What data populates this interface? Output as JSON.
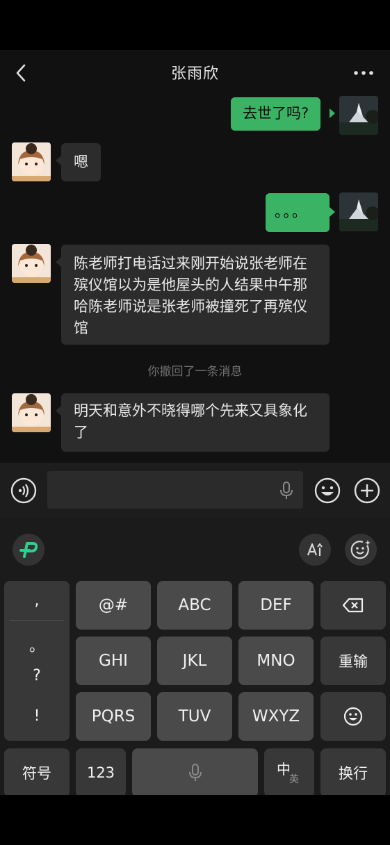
{
  "header": {
    "title": "张雨欣"
  },
  "messages": [
    {
      "side": "out",
      "text": "去世了吗?"
    },
    {
      "side": "in",
      "text": "嗯"
    },
    {
      "side": "out",
      "text": "。。。"
    },
    {
      "side": "in",
      "text": "陈老师打电话过来刚开始说张老师在殡仪馆以为是他屋头的人结果中午那哈陈老师说是张老师被撞死了再殡仪馆"
    },
    {
      "side": "system",
      "text": "你撤回了一条消息"
    },
    {
      "side": "in",
      "text": "明天和意外不晓得哪个先来又具象化了"
    }
  ],
  "keyboard": {
    "punct": [
      ",",
      "。",
      "?",
      "!"
    ],
    "row1": [
      "@#",
      "ABC",
      "DEF"
    ],
    "row2": [
      "GHI",
      "JKL",
      "MNO"
    ],
    "row3": [
      "PQRS",
      "TUV",
      "WXYZ"
    ],
    "reinput": "重输",
    "symbols": "符号",
    "numbers": "123",
    "lang_main": "中",
    "lang_sub": "英",
    "enter": "换行"
  },
  "colors": {
    "accent_green": "#3bb365",
    "bubble_in": "#2c2c2c",
    "chat_bg": "#111111"
  }
}
